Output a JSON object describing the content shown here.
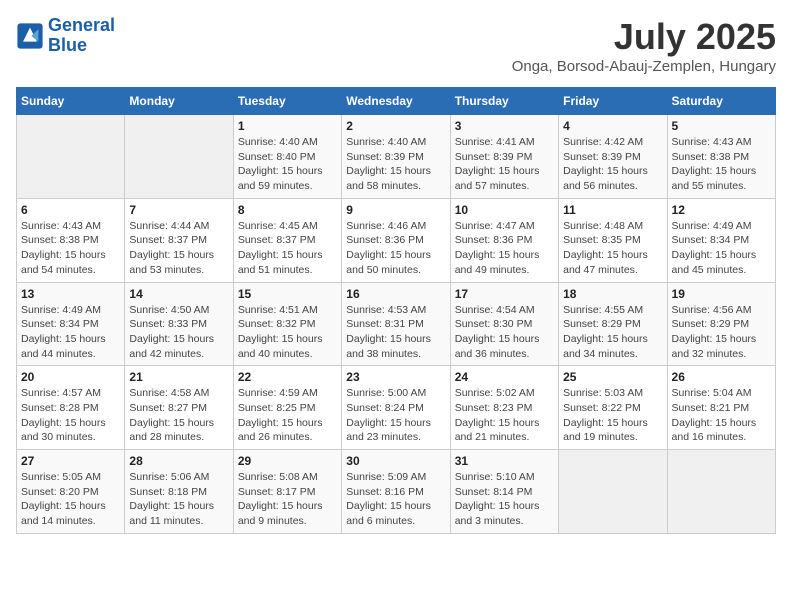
{
  "logo": {
    "line1": "General",
    "line2": "Blue"
  },
  "title": "July 2025",
  "subtitle": "Onga, Borsod-Abauj-Zemplen, Hungary",
  "days_of_week": [
    "Sunday",
    "Monday",
    "Tuesday",
    "Wednesday",
    "Thursday",
    "Friday",
    "Saturday"
  ],
  "weeks": [
    [
      {
        "day": "",
        "info": ""
      },
      {
        "day": "",
        "info": ""
      },
      {
        "day": "1",
        "sunrise": "4:40 AM",
        "sunset": "8:40 PM",
        "daylight": "15 hours and 59 minutes."
      },
      {
        "day": "2",
        "sunrise": "4:40 AM",
        "sunset": "8:39 PM",
        "daylight": "15 hours and 58 minutes."
      },
      {
        "day": "3",
        "sunrise": "4:41 AM",
        "sunset": "8:39 PM",
        "daylight": "15 hours and 57 minutes."
      },
      {
        "day": "4",
        "sunrise": "4:42 AM",
        "sunset": "8:39 PM",
        "daylight": "15 hours and 56 minutes."
      },
      {
        "day": "5",
        "sunrise": "4:43 AM",
        "sunset": "8:38 PM",
        "daylight": "15 hours and 55 minutes."
      }
    ],
    [
      {
        "day": "6",
        "sunrise": "4:43 AM",
        "sunset": "8:38 PM",
        "daylight": "15 hours and 54 minutes."
      },
      {
        "day": "7",
        "sunrise": "4:44 AM",
        "sunset": "8:37 PM",
        "daylight": "15 hours and 53 minutes."
      },
      {
        "day": "8",
        "sunrise": "4:45 AM",
        "sunset": "8:37 PM",
        "daylight": "15 hours and 51 minutes."
      },
      {
        "day": "9",
        "sunrise": "4:46 AM",
        "sunset": "8:36 PM",
        "daylight": "15 hours and 50 minutes."
      },
      {
        "day": "10",
        "sunrise": "4:47 AM",
        "sunset": "8:36 PM",
        "daylight": "15 hours and 49 minutes."
      },
      {
        "day": "11",
        "sunrise": "4:48 AM",
        "sunset": "8:35 PM",
        "daylight": "15 hours and 47 minutes."
      },
      {
        "day": "12",
        "sunrise": "4:49 AM",
        "sunset": "8:34 PM",
        "daylight": "15 hours and 45 minutes."
      }
    ],
    [
      {
        "day": "13",
        "sunrise": "4:49 AM",
        "sunset": "8:34 PM",
        "daylight": "15 hours and 44 minutes."
      },
      {
        "day": "14",
        "sunrise": "4:50 AM",
        "sunset": "8:33 PM",
        "daylight": "15 hours and 42 minutes."
      },
      {
        "day": "15",
        "sunrise": "4:51 AM",
        "sunset": "8:32 PM",
        "daylight": "15 hours and 40 minutes."
      },
      {
        "day": "16",
        "sunrise": "4:53 AM",
        "sunset": "8:31 PM",
        "daylight": "15 hours and 38 minutes."
      },
      {
        "day": "17",
        "sunrise": "4:54 AM",
        "sunset": "8:30 PM",
        "daylight": "15 hours and 36 minutes."
      },
      {
        "day": "18",
        "sunrise": "4:55 AM",
        "sunset": "8:29 PM",
        "daylight": "15 hours and 34 minutes."
      },
      {
        "day": "19",
        "sunrise": "4:56 AM",
        "sunset": "8:29 PM",
        "daylight": "15 hours and 32 minutes."
      }
    ],
    [
      {
        "day": "20",
        "sunrise": "4:57 AM",
        "sunset": "8:28 PM",
        "daylight": "15 hours and 30 minutes."
      },
      {
        "day": "21",
        "sunrise": "4:58 AM",
        "sunset": "8:27 PM",
        "daylight": "15 hours and 28 minutes."
      },
      {
        "day": "22",
        "sunrise": "4:59 AM",
        "sunset": "8:25 PM",
        "daylight": "15 hours and 26 minutes."
      },
      {
        "day": "23",
        "sunrise": "5:00 AM",
        "sunset": "8:24 PM",
        "daylight": "15 hours and 23 minutes."
      },
      {
        "day": "24",
        "sunrise": "5:02 AM",
        "sunset": "8:23 PM",
        "daylight": "15 hours and 21 minutes."
      },
      {
        "day": "25",
        "sunrise": "5:03 AM",
        "sunset": "8:22 PM",
        "daylight": "15 hours and 19 minutes."
      },
      {
        "day": "26",
        "sunrise": "5:04 AM",
        "sunset": "8:21 PM",
        "daylight": "15 hours and 16 minutes."
      }
    ],
    [
      {
        "day": "27",
        "sunrise": "5:05 AM",
        "sunset": "8:20 PM",
        "daylight": "15 hours and 14 minutes."
      },
      {
        "day": "28",
        "sunrise": "5:06 AM",
        "sunset": "8:18 PM",
        "daylight": "15 hours and 11 minutes."
      },
      {
        "day": "29",
        "sunrise": "5:08 AM",
        "sunset": "8:17 PM",
        "daylight": "15 hours and 9 minutes."
      },
      {
        "day": "30",
        "sunrise": "5:09 AM",
        "sunset": "8:16 PM",
        "daylight": "15 hours and 6 minutes."
      },
      {
        "day": "31",
        "sunrise": "5:10 AM",
        "sunset": "8:14 PM",
        "daylight": "15 hours and 3 minutes."
      },
      {
        "day": "",
        "info": ""
      },
      {
        "day": "",
        "info": ""
      }
    ]
  ]
}
